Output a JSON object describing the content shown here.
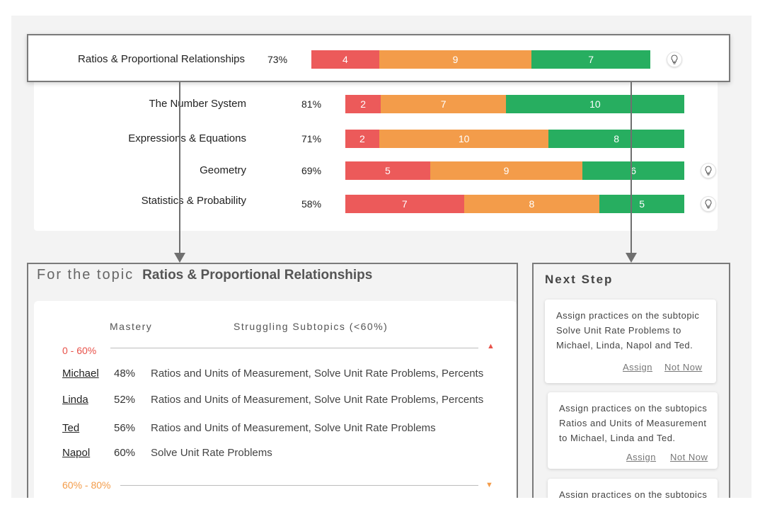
{
  "topics": [
    {
      "name": "Ratios & Proportional Relationships",
      "percent": "73%",
      "segments": [
        4,
        9,
        7
      ],
      "has_tip": true,
      "highlighted": true
    },
    {
      "name": "The Number System",
      "percent": "81%",
      "segments": [
        2,
        7,
        10
      ],
      "has_tip": false
    },
    {
      "name": "Expressions & Equations",
      "percent": "71%",
      "segments": [
        2,
        10,
        8
      ],
      "has_tip": false
    },
    {
      "name": "Geometry",
      "percent": "69%",
      "segments": [
        5,
        9,
        6
      ],
      "has_tip": true
    },
    {
      "name": "Statistics & Probability",
      "percent": "58%",
      "segments": [
        7,
        8,
        5
      ],
      "has_tip": true
    }
  ],
  "detail": {
    "title_prefix": "For the topic",
    "topic_name": "Ratios & Proportional Relationships",
    "col_mastery": "Mastery",
    "col_subtopics": "Struggling Subtopics (<60%)",
    "bands": [
      {
        "label": "0 - 60%",
        "color": "#e8524a",
        "direction": "up"
      },
      {
        "label": "60% - 80%",
        "color": "#f39c4a",
        "direction": "down"
      }
    ],
    "students": [
      {
        "name": "Michael",
        "score": "48%",
        "subtopics": "Ratios and Units of Measurement, Solve Unit Rate Problems, Percents"
      },
      {
        "name": "Linda",
        "score": "52%",
        "subtopics": "Ratios and Units of Measurement, Solve Unit Rate Problems, Percents"
      },
      {
        "name": "Ted",
        "score": "56%",
        "subtopics": "Ratios and Units of Measurement, Solve Unit Rate Problems"
      },
      {
        "name": "Napol",
        "score": "60%",
        "subtopics": "Solve Unit Rate Problems"
      }
    ]
  },
  "next_step": {
    "title": "Next Step",
    "cards": [
      {
        "text": "Assign practices on the subtopic Solve Unit Rate Problems to Michael, Linda, Napol and Ted.",
        "assign": "Assign",
        "dismiss": "Not Now"
      },
      {
        "text": "Assign practices on the subtopics Ratios and Units of Measurement to Michael, Linda and Ted.",
        "assign": "Assign",
        "dismiss": "Not Now"
      },
      {
        "text": "Assign practices on the subtopics",
        "assign": "",
        "dismiss": ""
      }
    ]
  },
  "colors": {
    "low": "#ec5a5a",
    "mid": "#f39c4a",
    "high": "#27ae60",
    "border": "#7a7a7a"
  },
  "icons": {
    "tip": "lightbulb-icon",
    "connector": "arrow-down-icon"
  }
}
